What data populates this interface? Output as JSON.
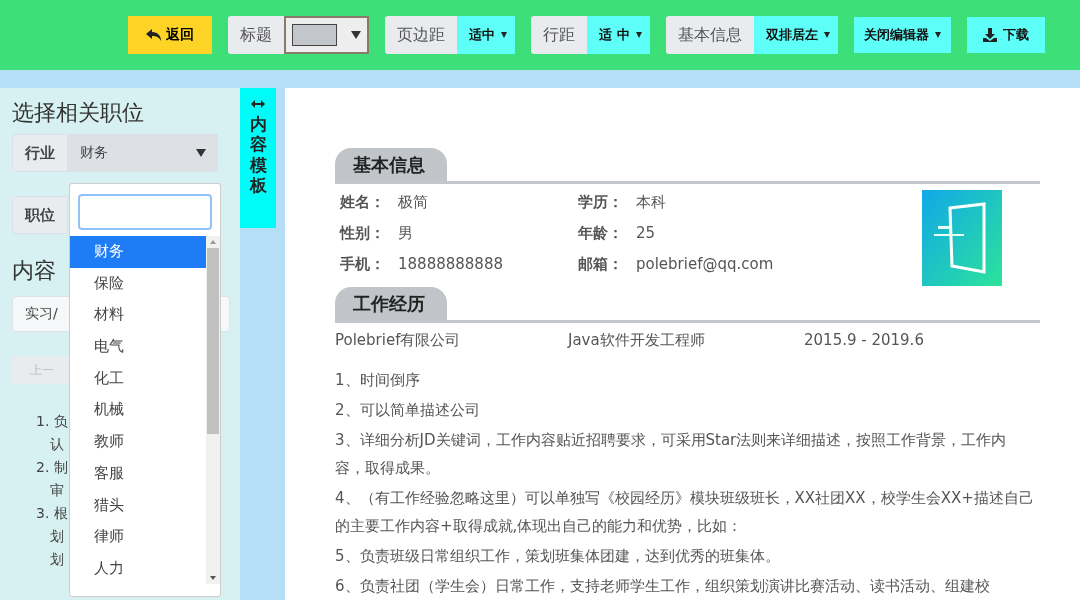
{
  "toolbar": {
    "back_button": "返回",
    "title_group": {
      "label": "标题"
    },
    "selects": [
      {
        "label": "页边距",
        "value": "适中"
      },
      {
        "label": "行距",
        "value": "适 中"
      },
      {
        "label": "基本信息",
        "value": "双排居左"
      }
    ],
    "editor_menu": "关闭编辑器",
    "download_button": "下载"
  },
  "sidebar": {
    "heading": "选择相关职位",
    "industry": {
      "label": "行业",
      "value": "财务"
    },
    "position": {
      "label": "职位"
    },
    "template_heading": "内容",
    "template_select": "实习/",
    "prev_button": "上一",
    "list_items": [
      [
        "1. 负",
        "认"
      ],
      [
        "2. 制",
        "审"
      ],
      [
        "3. 根",
        "划",
        "划"
      ]
    ]
  },
  "dropdown": {
    "options": [
      {
        "label": "财务",
        "selected": true
      },
      {
        "label": "保险",
        "selected": false
      },
      {
        "label": "材料",
        "selected": false
      },
      {
        "label": "电气",
        "selected": false
      },
      {
        "label": "化工",
        "selected": false
      },
      {
        "label": "机械",
        "selected": false
      },
      {
        "label": "教师",
        "selected": false
      },
      {
        "label": "客服",
        "selected": false
      },
      {
        "label": "猎头",
        "selected": false
      },
      {
        "label": "律师",
        "selected": false
      },
      {
        "label": "人力",
        "selected": false
      }
    ]
  },
  "side_tab": "内容模板",
  "resume": {
    "basic_title": "基本信息",
    "fields": [
      {
        "label": "姓名：",
        "value": "极简"
      },
      {
        "label": "学历：",
        "value": "本科"
      },
      {
        "label": "性别：",
        "value": "男"
      },
      {
        "label": "年龄：",
        "value": "25"
      },
      {
        "label": "手机：",
        "value": "18888888888"
      },
      {
        "label": "邮箱：",
        "value": "polebrief@qq.com"
      }
    ],
    "work_title": "工作经历",
    "company": "Polebrief有限公司",
    "role": "Java软件开发工程师",
    "period": "2015.9 - 2019.6",
    "paragraphs": [
      "1、时间倒序",
      "2、可以简单描述公司",
      "3、详细分析JD关键词，工作内容贴近招聘要求，可采用Star法则来详细描述，按照工作背景，工作内容，取得成果。",
      "4、（有工作经验忽略这里）可以单独写《校园经历》模块班级班长，XX社团XX，校学生会XX+描述自己的主要工作内容+取得成就,体现出自己的能力和优势，比如：",
      "5、负责班级日常组织工作，策划班集体团建，达到优秀的班集体。",
      "6、负责社团（学生会）日常工作，支持老师学生工作，组织策划演讲比赛活动、读书活动、组建校"
    ]
  }
}
